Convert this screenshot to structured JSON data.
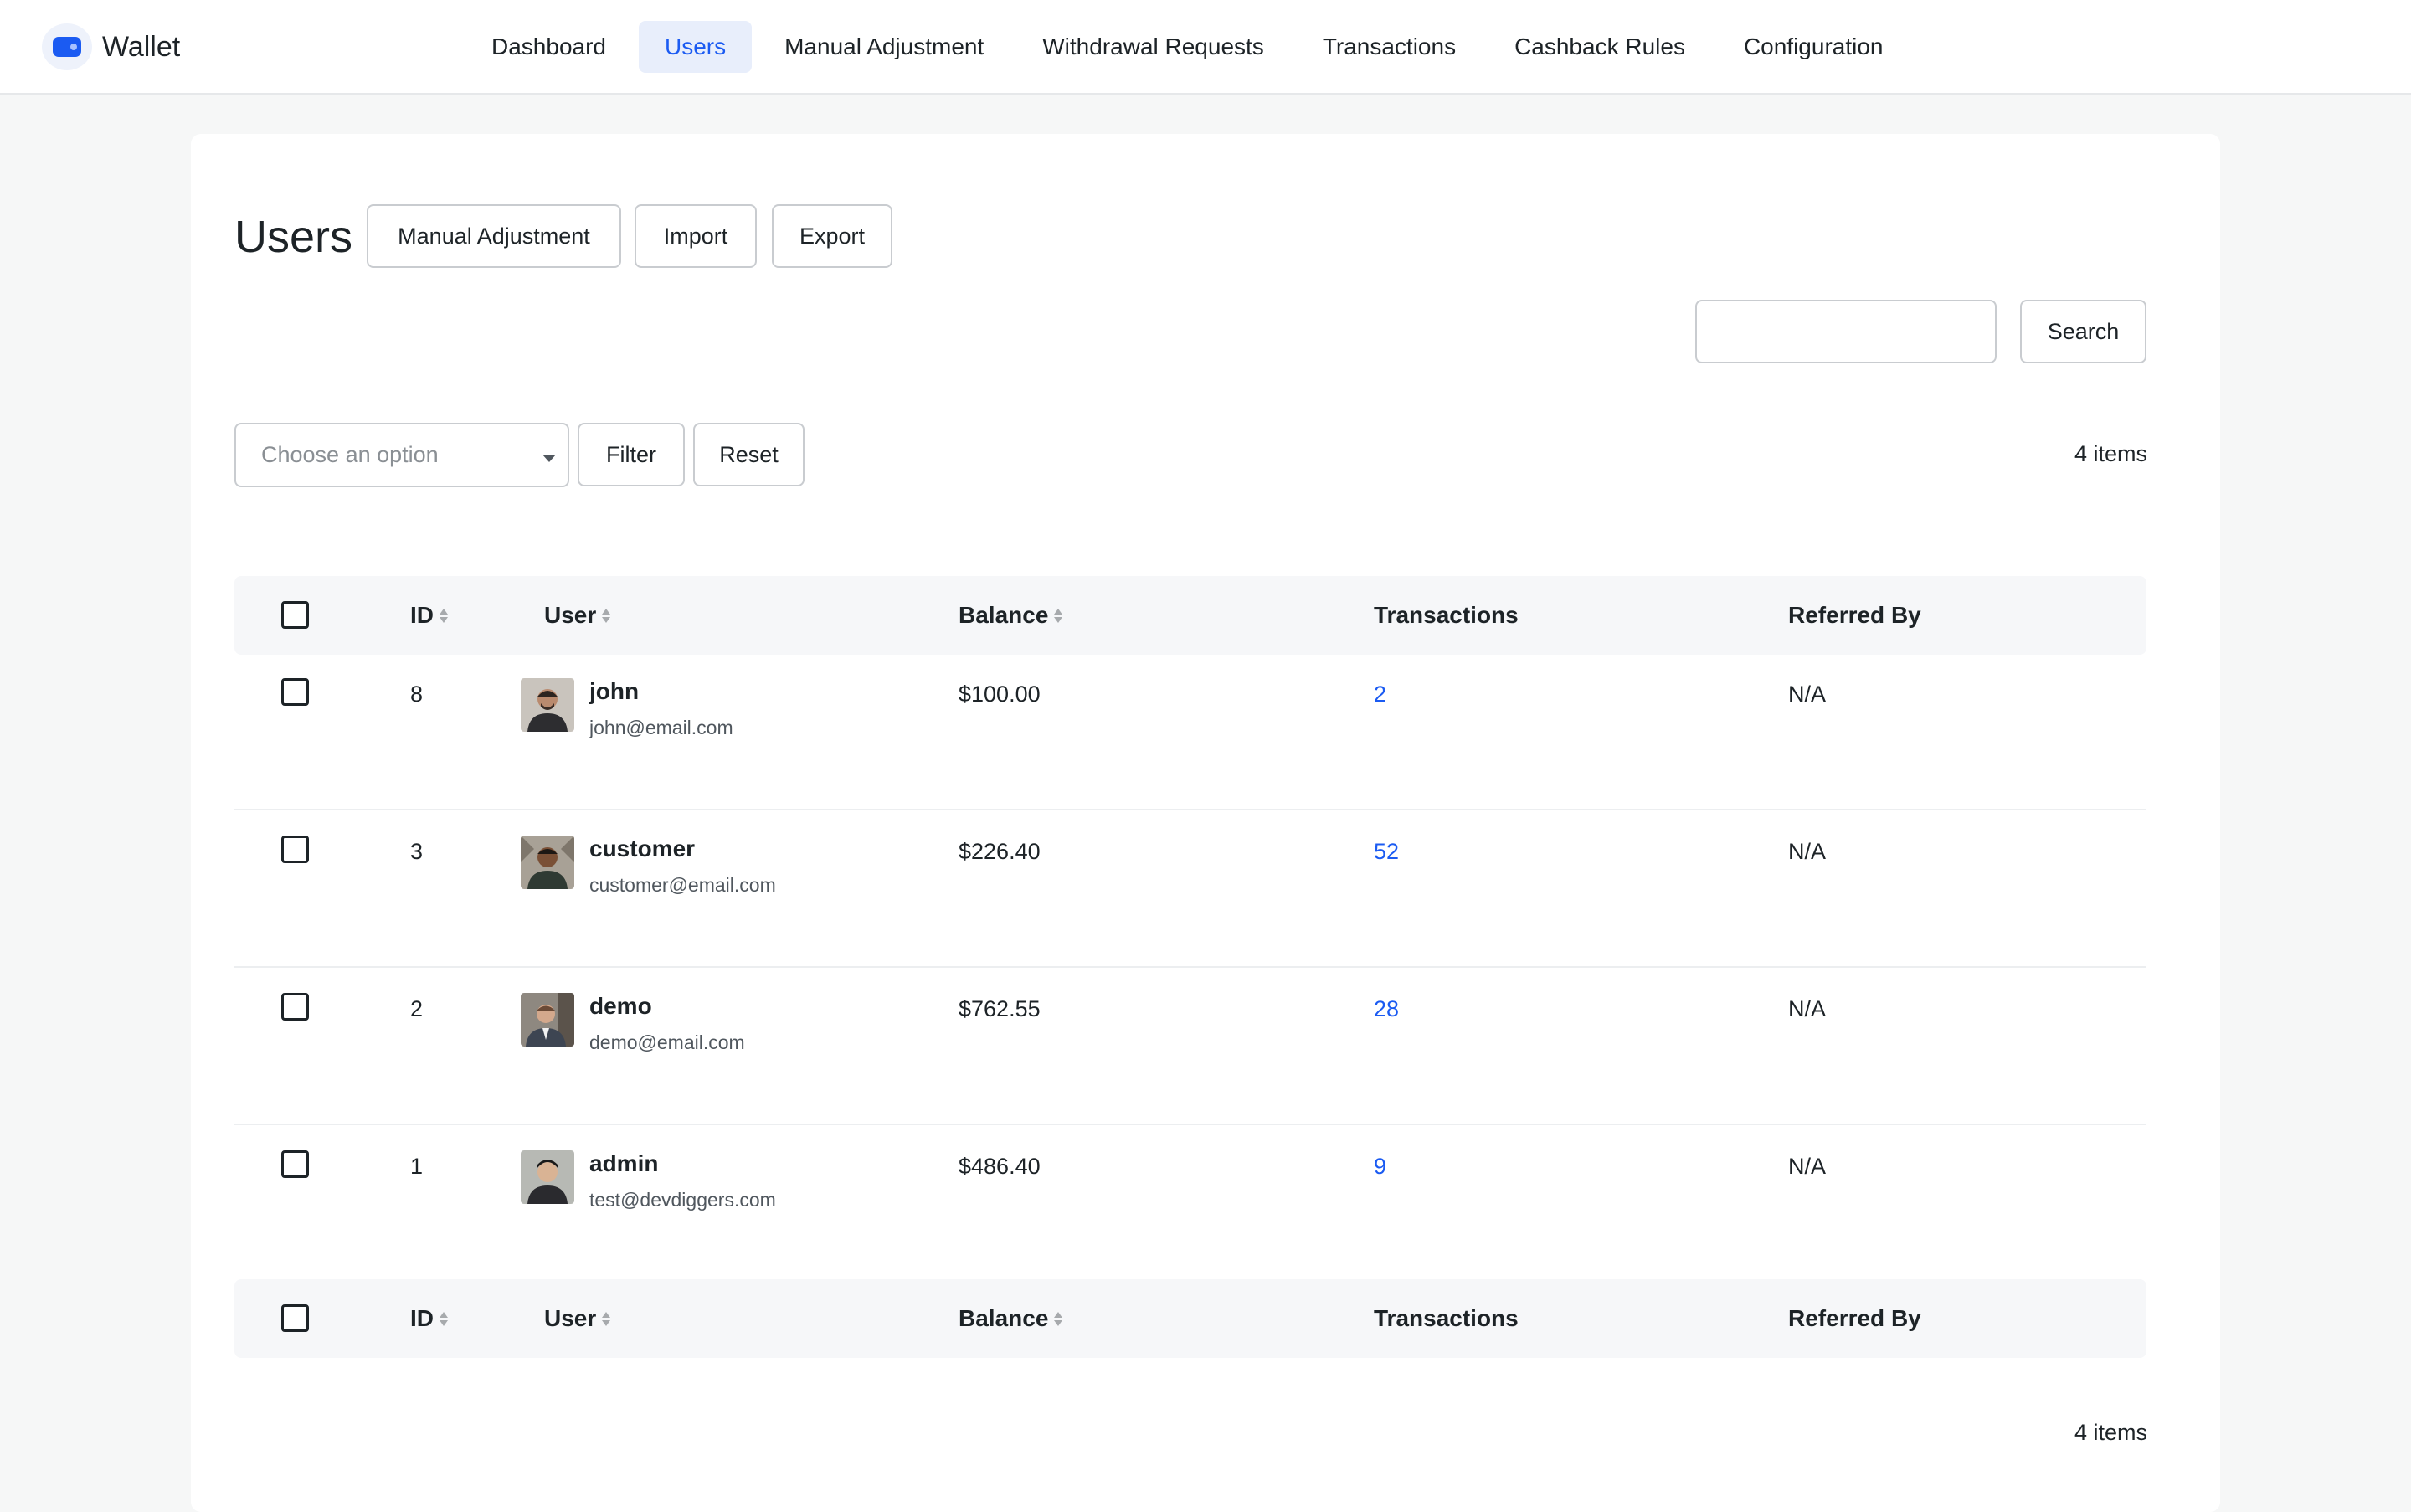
{
  "app": {
    "name": "Wallet",
    "accent": "#1b5bf2"
  },
  "nav": {
    "items": [
      {
        "label": "Dashboard",
        "active": false
      },
      {
        "label": "Users",
        "active": true
      },
      {
        "label": "Manual Adjustment",
        "active": false
      },
      {
        "label": "Withdrawal Requests",
        "active": false
      },
      {
        "label": "Transactions",
        "active": false
      },
      {
        "label": "Cashback Rules",
        "active": false
      },
      {
        "label": "Configuration",
        "active": false
      }
    ]
  },
  "page": {
    "title": "Users",
    "actions": {
      "manual_adjustment": "Manual Adjustment",
      "import": "Import",
      "export": "Export"
    }
  },
  "search": {
    "value": "",
    "button": "Search"
  },
  "filter": {
    "placeholder": "Choose an option",
    "filter_button": "Filter",
    "reset_button": "Reset"
  },
  "items_count": "4 items",
  "table": {
    "columns": {
      "id": "ID",
      "user": "User",
      "balance": "Balance",
      "transactions": "Transactions",
      "referred_by": "Referred By"
    },
    "rows": [
      {
        "id": "8",
        "name": "john",
        "email": "john@email.com",
        "balance": "$100.00",
        "transactions": "2",
        "referred_by": "N/A",
        "avatar": "avatar-john"
      },
      {
        "id": "3",
        "name": "customer",
        "email": "customer@email.com",
        "balance": "$226.40",
        "transactions": "52",
        "referred_by": "N/A",
        "avatar": "avatar-customer"
      },
      {
        "id": "2",
        "name": "demo",
        "email": "demo@email.com",
        "balance": "$762.55",
        "transactions": "28",
        "referred_by": "N/A",
        "avatar": "avatar-demo"
      },
      {
        "id": "1",
        "name": "admin",
        "email": "test@devdiggers.com",
        "balance": "$486.40",
        "transactions": "9",
        "referred_by": "N/A",
        "avatar": "avatar-admin"
      }
    ]
  }
}
